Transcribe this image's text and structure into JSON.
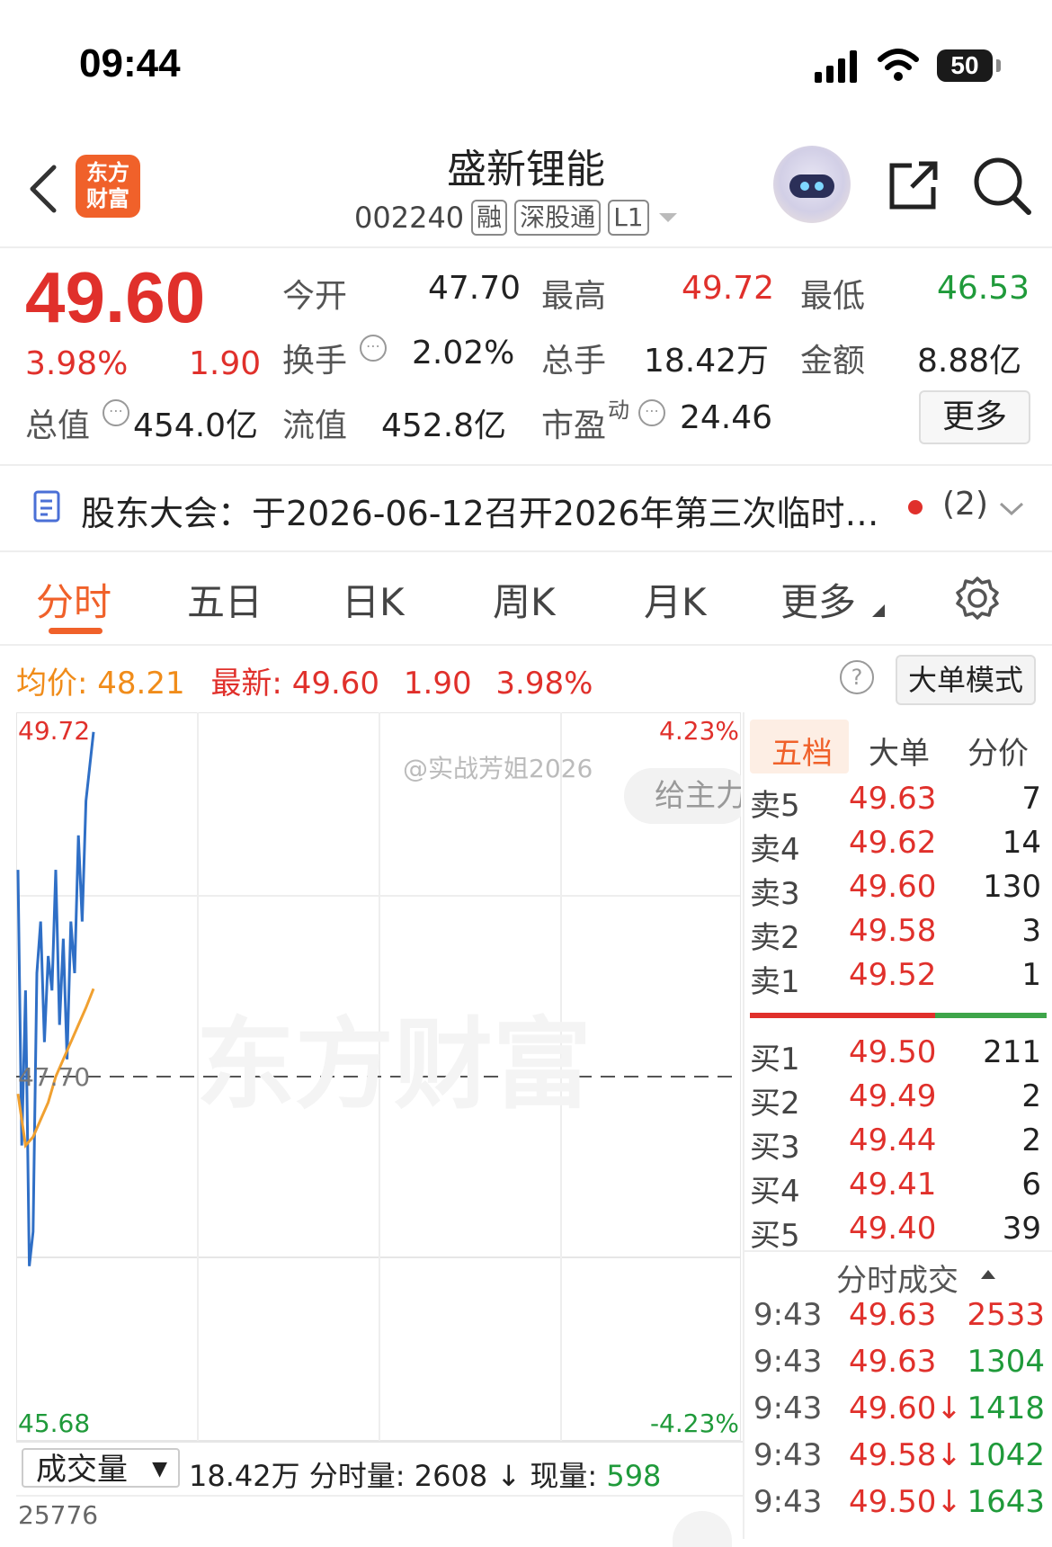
{
  "status_bar": {
    "time": "09:44",
    "battery": "50"
  },
  "header": {
    "logo_line1": "东方",
    "logo_line2": "财富",
    "stock_name": "盛新锂能",
    "stock_code": "002240",
    "tags": [
      "融",
      "深股通",
      "L1"
    ]
  },
  "quote": {
    "price": "49.60",
    "change_pct": "3.98%",
    "change": "1.90",
    "open_label": "今开",
    "open": "47.70",
    "high_label": "最高",
    "high": "49.72",
    "low_label": "最低",
    "low": "46.53",
    "turnover_label": "换手",
    "turnover": "2.02%",
    "volume_label": "总手",
    "volume": "18.42万",
    "amount_label": "金额",
    "amount": "8.88亿",
    "mktcap_label": "总值",
    "mktcap": "454.0亿",
    "float_label": "流值",
    "float": "452.8亿",
    "pe_label": "市盈",
    "pe_sup": "动",
    "pe": "24.46",
    "more_label": "更多"
  },
  "notice": {
    "text": "股东大会：于2026-06-12召开2026年第三次临时…",
    "count": "(2)"
  },
  "tabs": [
    "分时",
    "五日",
    "日K",
    "周K",
    "月K",
    "更多"
  ],
  "avg_row": {
    "avg_label": "均价:",
    "avg": "48.21",
    "latest_label": "最新:",
    "latest": "49.60",
    "change": "1.90",
    "change_pct": "3.98%",
    "big_order_label": "大单模式"
  },
  "chart_data": {
    "type": "line",
    "y_labels": {
      "top": "49.72",
      "mid": "47.70",
      "bottom": "45.68"
    },
    "pct_labels": {
      "top": "4.23%",
      "bottom": "-4.23%"
    },
    "ylim": [
      45.68,
      49.72
    ],
    "series": [
      {
        "name": "最新",
        "color": "#2f6fc6",
        "values": [
          48.9,
          47.3,
          48.2,
          46.6,
          46.8,
          48.3,
          48.6,
          47.9,
          48.4,
          48.2,
          48.9,
          48.0,
          48.5,
          47.8,
          48.6,
          48.3,
          49.1,
          48.6,
          49.3,
          49.5,
          49.7
        ]
      },
      {
        "name": "均价",
        "color": "#f0a030",
        "values": [
          47.6,
          47.3,
          47.35,
          47.45,
          47.55,
          47.7,
          47.8,
          47.9,
          48.0,
          48.1,
          48.21
        ]
      }
    ]
  },
  "watermark": {
    "weibo": "@实战芳姐2026",
    "tip": "给主力",
    "brand": "东方财富"
  },
  "order_book": {
    "tabs": [
      "五档",
      "大单",
      "分价"
    ],
    "asks": [
      {
        "label": "卖5",
        "price": "49.63",
        "qty": "7"
      },
      {
        "label": "卖4",
        "price": "49.62",
        "qty": "14"
      },
      {
        "label": "卖3",
        "price": "49.60",
        "qty": "130"
      },
      {
        "label": "卖2",
        "price": "49.58",
        "qty": "3"
      },
      {
        "label": "卖1",
        "price": "49.52",
        "qty": "1"
      }
    ],
    "bids": [
      {
        "label": "买1",
        "price": "49.50",
        "qty": "211"
      },
      {
        "label": "买2",
        "price": "49.49",
        "qty": "2"
      },
      {
        "label": "买3",
        "price": "49.44",
        "qty": "2"
      },
      {
        "label": "买4",
        "price": "49.41",
        "qty": "6"
      },
      {
        "label": "买5",
        "price": "49.40",
        "qty": "39"
      }
    ]
  },
  "ticks": {
    "title": "分时成交",
    "rows": [
      {
        "time": "9:43",
        "price": "49.63",
        "vol": "2533",
        "vol_color": "#e0302b"
      },
      {
        "time": "9:43",
        "price": "49.63",
        "vol": "1304",
        "vol_color": "#1f9a3a"
      },
      {
        "time": "9:43",
        "price": "49.60↓",
        "vol": "1418",
        "vol_color": "#1f9a3a"
      },
      {
        "time": "9:43",
        "price": "49.58↓",
        "vol": "1042",
        "vol_color": "#1f9a3a"
      },
      {
        "time": "9:43",
        "price": "49.50↓",
        "vol": "1643",
        "vol_color": "#1f9a3a"
      }
    ]
  },
  "volume": {
    "select": "成交量",
    "total": "18.42万",
    "minute_label": "分时量:",
    "minute": "2608",
    "current_label": "现量:",
    "current": "598",
    "axis_top": "25776"
  }
}
